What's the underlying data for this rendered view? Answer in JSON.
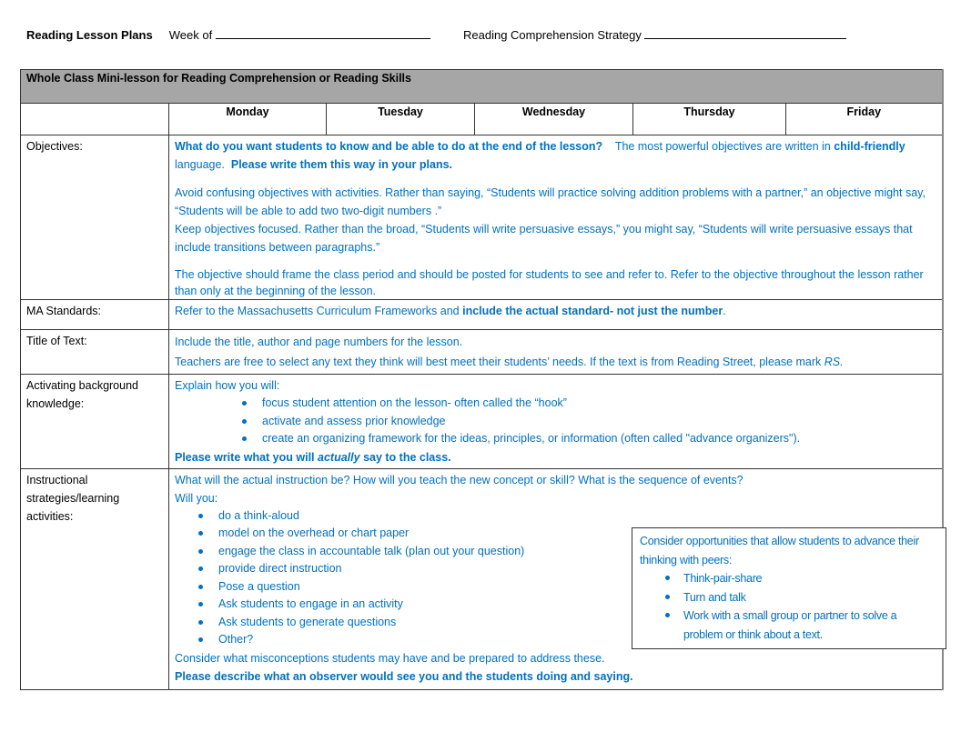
{
  "header": {
    "title": "Reading Lesson Plans",
    "week_label": "Week of",
    "strategy_label": "Reading Comprehension Strategy"
  },
  "table": {
    "banner": "Whole Class Mini-lesson for Reading Comprehension or Reading Skills",
    "days": [
      "Monday",
      "Tuesday",
      "Wednesday",
      "Thursday",
      "Friday"
    ],
    "rows": {
      "objectives": {
        "label": "Objectives:",
        "p1_bold": "What do you want students to know and be able to do at the end of the lesson?",
        "p1_rest": "The most powerful objectives are written in",
        "p1_bold2": "child-friendly",
        "p1_mid": "language.",
        "p1_bold3": "Please write them this way in your plans.",
        "p2": "Avoid confusing objectives with activities.  Rather than saying, “Students will practice solving addition problems with a partner,” an objective might say, “Students will be able to add two two-digit numbers .”",
        "p3": "Keep objectives focused. Rather than the broad, “Students will write persuasive essays,” you might say, “Students will write persuasive essays that include transitions between paragraphs.”",
        "p4": "The objective should frame the class period and should be posted for students to see and refer to. Refer to the objective throughout the lesson rather than only at the beginning of the lesson."
      },
      "standards": {
        "label": "MA Standards:",
        "text": "Refer to the Massachusetts Curriculum Frameworks and",
        "bold": "include the actual standard- not just the number",
        "end": "."
      },
      "title_of_text": {
        "label": "Title of Text:",
        "line1": "Include the title, author and page numbers for the lesson.",
        "line2": "Teachers are free to select any text they think will best meet their students’ needs. If the text is from Reading Street, please mark",
        "line2_italic": "RS."
      },
      "background": {
        "label": "Activating background knowledge:",
        "intro": "Explain how you will:",
        "bullets": [
          "focus student attention on the lesson- often called the “hook”",
          "activate and assess prior knowledge",
          "create an organizing framework for the ideas, principles, or information (often called \"advance organizers\")."
        ],
        "closing_a": "Please write what you will",
        "closing_italic": "actually",
        "closing_b": "say to the class."
      },
      "instruction": {
        "label": "Instructional strategies/learning activities:",
        "intro": "What will the actual instruction be?  How will you teach the new concept or skill?  What is the sequence of events?",
        "will_you": "Will you:",
        "bullets": [
          "do a think-aloud",
          "model on the overhead or chart paper",
          "engage the class in accountable talk (plan out your question)",
          "provide direct instruction",
          "Pose a question",
          "Ask students to engage in an activity",
          "Ask students to generate questions",
          "Other?"
        ],
        "misconceptions": "Consider what misconceptions students may have and be prepared to address these.",
        "closing": "Please describe what an observer would see you and the students doing and saying."
      }
    }
  },
  "callout": {
    "intro": "Consider opportunities that allow students to advance their thinking with peers:",
    "bullets": [
      "Think-pair-share",
      "Turn and talk",
      "Work with a small group or partner to solve a problem or think about a text."
    ]
  }
}
